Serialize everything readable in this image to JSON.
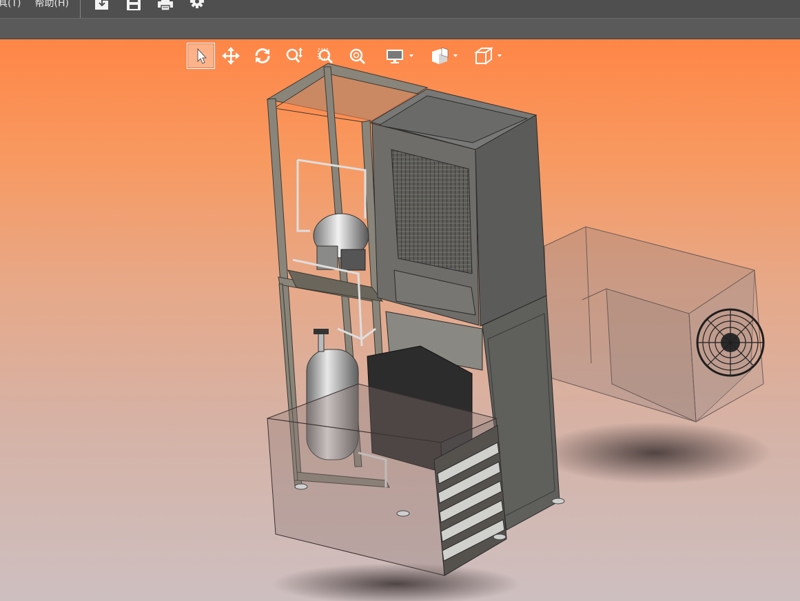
{
  "menu": {
    "items": [
      {
        "label": "具(T)"
      },
      {
        "label": "帮助(H)"
      }
    ],
    "toolbar": [
      {
        "icon": "open-file-icon"
      },
      {
        "icon": "save-icon"
      },
      {
        "icon": "print-icon"
      },
      {
        "icon": "gear-icon"
      }
    ]
  },
  "view_toolbar": {
    "tools": [
      {
        "icon": "select-arrow-icon",
        "active": true
      },
      {
        "icon": "pan-icon"
      },
      {
        "icon": "rotate-icon"
      },
      {
        "icon": "zoom-interactive-icon"
      },
      {
        "icon": "zoom-window-icon"
      },
      {
        "icon": "zoom-fit-icon"
      },
      {
        "icon": "display-monitor-icon",
        "has_dropdown": true
      },
      {
        "icon": "section-view-icon",
        "has_dropdown": true
      },
      {
        "icon": "view-cube-icon",
        "has_dropdown": true
      }
    ]
  },
  "colors": {
    "menubar": "#4f4f4f",
    "subbar": "#5a5a5a",
    "viewport_top": "#ff8646",
    "viewport_bottom": "#cdbfc0",
    "frame": "#7a7568",
    "cabinet": "#6b6b6a"
  }
}
